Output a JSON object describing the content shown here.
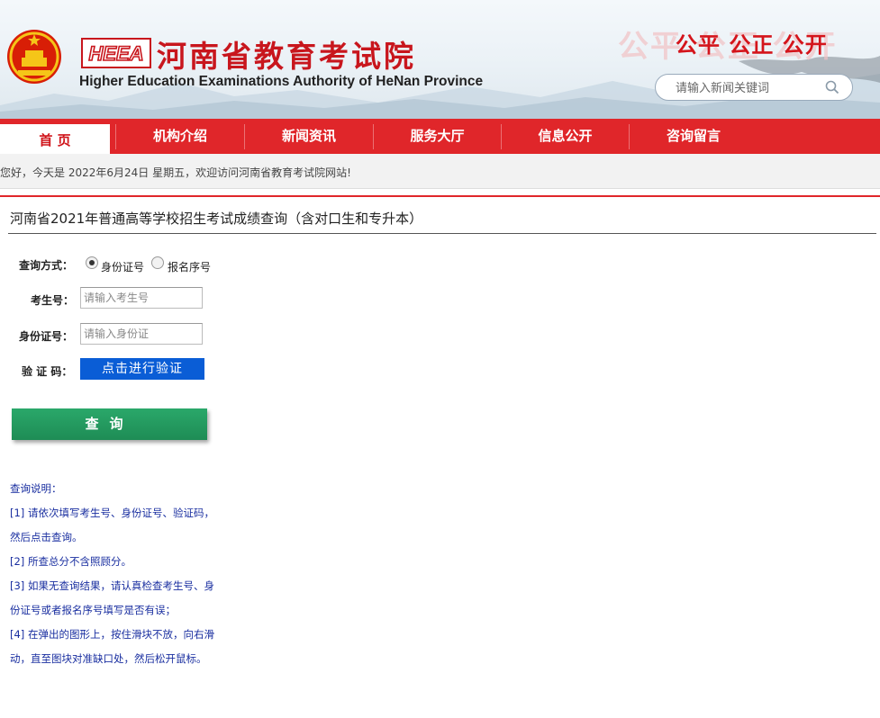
{
  "header": {
    "heea_logo": "HEEA",
    "cn_title": "河南省教育考试院",
    "en_title": "Higher Education Examinations Authority of HeNan Province",
    "slogan": "公平 公正 公开",
    "slogan_shadow": "公平 公正 公开",
    "search_placeholder": "请输入新闻关键词"
  },
  "nav": [
    {
      "label": "首 页",
      "active": true
    },
    {
      "label": "机构介绍",
      "active": false
    },
    {
      "label": "新闻资讯",
      "active": false
    },
    {
      "label": "服务大厅",
      "active": false
    },
    {
      "label": "信息公开",
      "active": false
    },
    {
      "label": "咨询留言",
      "active": false
    }
  ],
  "welcome": "您好，今天是 2022年6月24日 星期五，欢迎访问河南省教育考试院网站!",
  "page_title": "河南省2021年普通高等学校招生考试成绩查询（含对口生和专升本）",
  "form": {
    "query_mode_label": "查询方式：",
    "radio_id_label": "身份证号",
    "radio_reg_label": "报名序号",
    "exam_no_label": "考生号：",
    "exam_no_placeholder": "请输入考生号",
    "id_label": "身份证号：",
    "id_placeholder": "请输入身份证",
    "captcha_label": "验 证 码：",
    "verify_button": "点击进行验证",
    "query_button": "查询"
  },
  "notes": [
    "查询说明：",
    "[1] 请依次填写考生号、身份证号、验证码，然后点击查询。",
    "[2] 所查总分不含照顾分。",
    "[3] 如果无查询结果，请认真检查考生号、身份证号或者报名序号填写是否有误；",
    "[4] 在弹出的图形上，按住滑块不放，向右滑动，直至图块对准缺口处，然后松开鼠标。"
  ],
  "colors": {
    "brand_red": "#e0262a",
    "verify_blue": "#0a5dd6",
    "query_green": "#1e8c55",
    "notes_blue": "#1a2fa0"
  }
}
